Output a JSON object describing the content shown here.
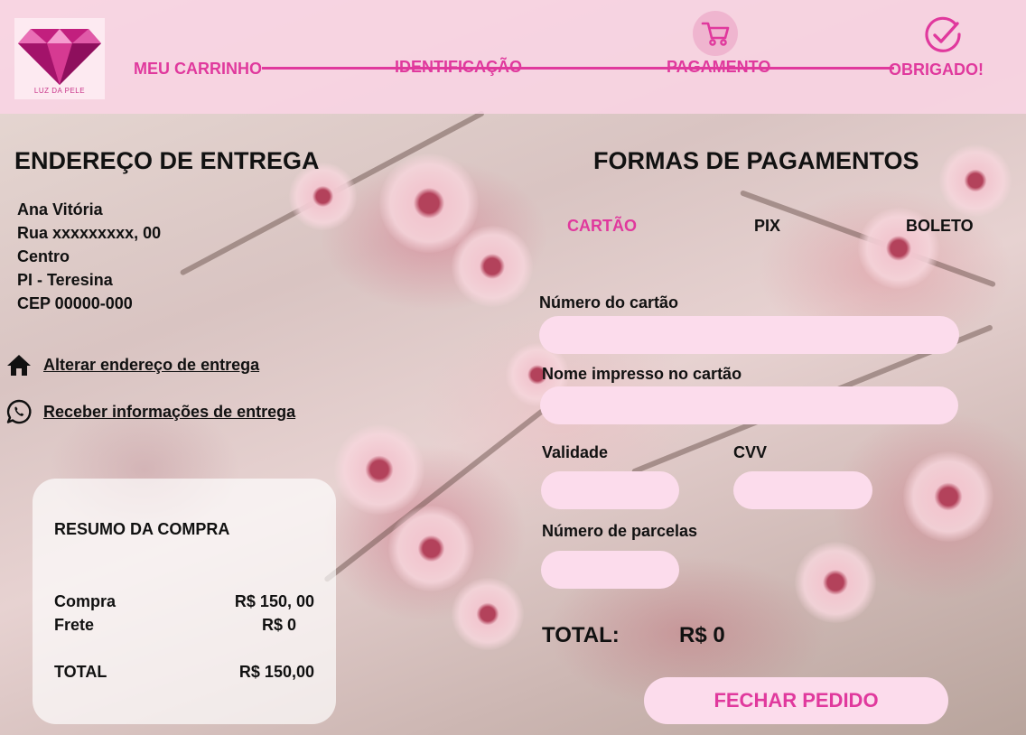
{
  "brand": {
    "logo_text": "LUZ DA PELE",
    "accent": "#e0399d"
  },
  "steps": [
    {
      "label": "MEU CARRINHO"
    },
    {
      "label": "IDENTIFICAÇÃO"
    },
    {
      "label": "PAGAMENTO",
      "icon": "cart-icon"
    },
    {
      "label": "OBRIGADO!",
      "icon": "check-circle-icon"
    }
  ],
  "address": {
    "title": "ENDEREÇO DE ENTREGA",
    "lines": [
      "Ana Vitória",
      "Rua xxxxxxxxx, 00",
      "Centro",
      "PI - Teresina",
      "CEP 00000-000"
    ],
    "change_link": "Alterar endereço de entrega",
    "whatsapp_link": "Receber informações de entrega"
  },
  "summary": {
    "title": "RESUMO DA COMPRA",
    "rows": [
      {
        "label": "Compra",
        "value": "R$ 150, 00"
      },
      {
        "label": "Frete",
        "value": "R$  0"
      },
      {
        "label": "TOTAL",
        "value": "R$ 150,00"
      }
    ]
  },
  "payment": {
    "title": "FORMAS DE PAGAMENTOS",
    "tabs": [
      {
        "label": "CARTÃO",
        "active": true
      },
      {
        "label": "PIX",
        "active": false
      },
      {
        "label": "BOLETO",
        "active": false
      }
    ],
    "fields": {
      "card_number": {
        "label": "Número do cartão",
        "value": ""
      },
      "card_name": {
        "label": "Nome impresso no cartão",
        "value": ""
      },
      "expiry": {
        "label": "Validade",
        "value": ""
      },
      "cvv": {
        "label": "CVV",
        "value": ""
      },
      "installments": {
        "label": "Número de parcelas",
        "value": ""
      }
    },
    "total_label": "TOTAL:",
    "total_value": "R$ 0",
    "submit_label": "FECHAR PEDIDO"
  }
}
